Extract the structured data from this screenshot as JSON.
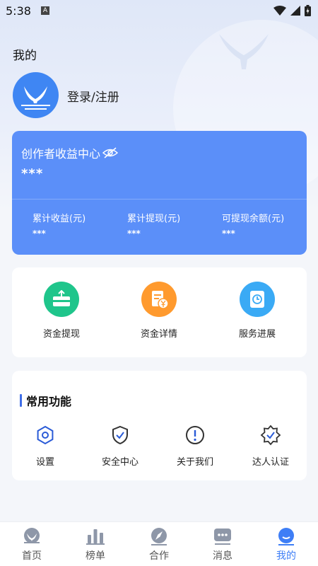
{
  "status_bar": {
    "time": "5:38",
    "notif_letter": "A"
  },
  "profile": {
    "title": "我的",
    "login_label": "登录/注册"
  },
  "earnings": {
    "title": "创作者收益中心",
    "total": "***",
    "stats": [
      {
        "label": "累计收益(元)",
        "value": "***"
      },
      {
        "label": "累计提现(元)",
        "value": "***"
      },
      {
        "label": "可提现余额(元)",
        "value": "***"
      }
    ]
  },
  "funds": {
    "items": [
      {
        "label": "资金提现",
        "icon": "wallet-withdraw-icon",
        "color": "#1fc58b"
      },
      {
        "label": "资金详情",
        "icon": "receipt-yen-icon",
        "color": "#ff9a2e"
      },
      {
        "label": "服务进展",
        "icon": "clock-doc-icon",
        "color": "#3aaaf5"
      }
    ]
  },
  "common_functions": {
    "title": "常用功能",
    "items": [
      {
        "label": "设置",
        "icon": "settings-icon"
      },
      {
        "label": "安全中心",
        "icon": "shield-check-icon"
      },
      {
        "label": "关于我们",
        "icon": "info-circle-icon"
      },
      {
        "label": "达人认证",
        "icon": "badge-check-icon"
      }
    ]
  },
  "tabs": [
    {
      "label": "首页",
      "icon": "home-icon"
    },
    {
      "label": "榜单",
      "icon": "ranking-icon"
    },
    {
      "label": "合作",
      "icon": "compass-icon"
    },
    {
      "label": "消息",
      "icon": "message-icon"
    },
    {
      "label": "我的",
      "icon": "profile-icon",
      "active": true
    }
  ],
  "colors": {
    "accent": "#3e7ef6",
    "card_blue": "#5b8ff9",
    "background": "#f4f6fa"
  }
}
